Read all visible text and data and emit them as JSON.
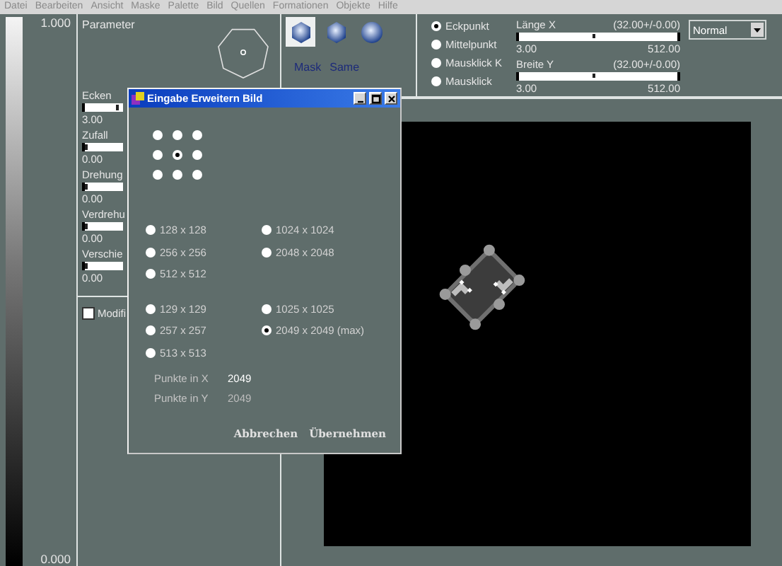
{
  "menu": [
    "Datei",
    "Bearbeiten",
    "Ansicht",
    "Maske",
    "Palette",
    "Bild",
    "Quellen",
    "Formationen",
    "Objekte",
    "Hilfe"
  ],
  "gradient_scale": {
    "top_label": "1.000",
    "bottom_label": "0.000"
  },
  "parameter_panel": {
    "title": "Parameter",
    "sliders": [
      {
        "label": "Ecken",
        "level": 0.85,
        "value": "3.00"
      },
      {
        "label": "Zufall",
        "level": 0.1,
        "value": "0.00"
      },
      {
        "label": "Drehung",
        "level": 0.1,
        "value": "0.00"
      },
      {
        "label": "Verdrehu",
        "level": 0.1,
        "value": "0.00"
      },
      {
        "label": "Verschie",
        "level": 0.1,
        "value": "0.00"
      }
    ],
    "checkbox": {
      "label": "Modifi",
      "checked": false
    }
  },
  "toolbar": {
    "shapes": [
      {
        "kind": "hexagon",
        "selected": true
      },
      {
        "kind": "hexagon",
        "selected": false
      },
      {
        "kind": "circle",
        "selected": false
      }
    ],
    "labels": [
      "Mask",
      "Same"
    ],
    "modes": [
      {
        "label": "Eckpunkt",
        "selected": true
      },
      {
        "label": "Mittelpunkt",
        "selected": false
      },
      {
        "label": "Mausklick K",
        "selected": false
      },
      {
        "label": "Mausklick",
        "selected": false
      }
    ],
    "sliders": [
      {
        "label": "Länge X",
        "reading": "(32.00+/-0.00)",
        "level": 0.47,
        "min": "3.00",
        "max": "512.00"
      },
      {
        "label": "Breite Y",
        "reading": "(32.00+/-0.00)",
        "level": 0.47,
        "min": "3.00",
        "max": "512.00"
      }
    ],
    "blend_mode": {
      "value": "Normal"
    }
  },
  "dialog": {
    "title": "Eingabe Erweitern Bild",
    "anchor": [
      {
        "selected": false
      },
      {
        "selected": false
      },
      {
        "selected": false
      },
      {
        "selected": false
      },
      {
        "selected": true
      },
      {
        "selected": false
      },
      {
        "selected": false
      },
      {
        "selected": false
      },
      {
        "selected": false
      }
    ],
    "size_groups": [
      {
        "left": [
          {
            "label": "128 x 128",
            "selected": false
          },
          {
            "label": "256 x 256",
            "selected": false
          },
          {
            "label": "512 x 512",
            "selected": false
          }
        ],
        "right": [
          {
            "label": "1024 x 1024",
            "selected": false
          },
          {
            "label": "2048 x 2048",
            "selected": false
          }
        ]
      },
      {
        "left": [
          {
            "label": "129 x 129",
            "selected": false
          },
          {
            "label": "257 x 257",
            "selected": false
          },
          {
            "label": "513 x 513",
            "selected": false
          }
        ],
        "right": [
          {
            "label": "1025 x 1025",
            "selected": false
          },
          {
            "label": "2049 x 2049 (max)",
            "selected": true
          }
        ]
      }
    ],
    "fields": [
      {
        "label": "Punkte in X",
        "value": "2049",
        "disabled": false
      },
      {
        "label": "Punkte in Y",
        "value": "2049",
        "disabled": true
      }
    ],
    "buttons": [
      "Abbrechen",
      "Übernehmen"
    ]
  }
}
